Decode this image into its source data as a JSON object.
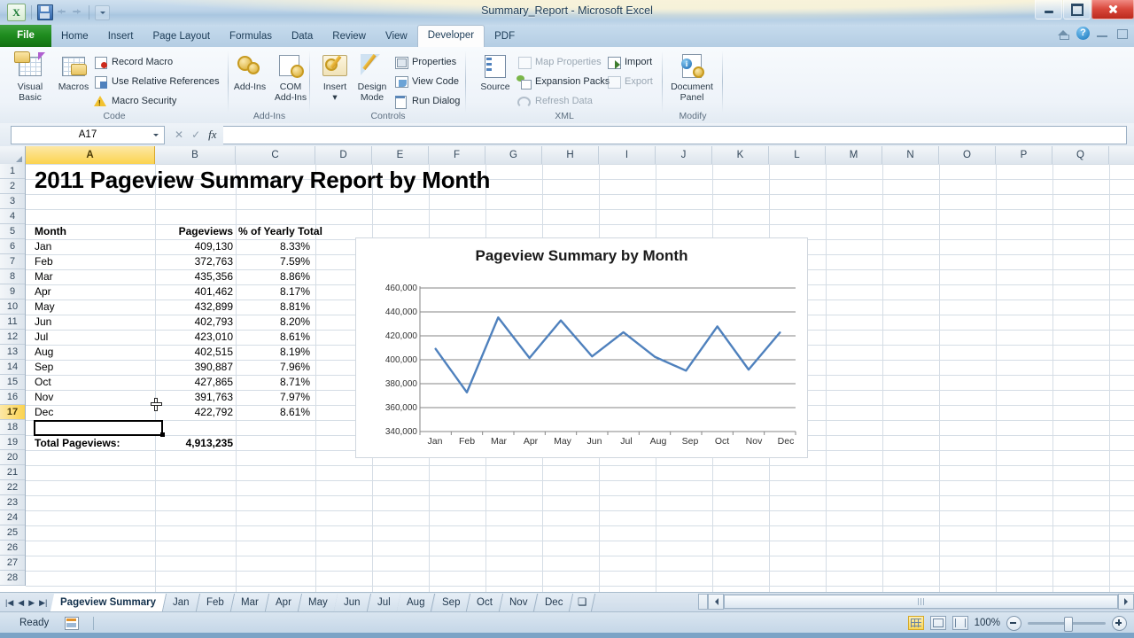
{
  "window": {
    "title": "Summary_Report  -  Microsoft Excel",
    "qat": {
      "excel_logo": "excel-logo",
      "save": "save-icon",
      "undo": "undo-icon",
      "redo": "redo-icon",
      "customize": "customize-qat-icon"
    },
    "buttons": {
      "minimize": "minimize",
      "maximize": "maximize",
      "close": "close"
    }
  },
  "ribbon": {
    "tabs": [
      {
        "label": "File",
        "active": false
      },
      {
        "label": "Home",
        "active": false
      },
      {
        "label": "Insert",
        "active": false
      },
      {
        "label": "Page Layout",
        "active": false
      },
      {
        "label": "Formulas",
        "active": false
      },
      {
        "label": "Data",
        "active": false
      },
      {
        "label": "Review",
        "active": false
      },
      {
        "label": "View",
        "active": false
      },
      {
        "label": "Developer",
        "active": true
      },
      {
        "label": "PDF",
        "active": false
      }
    ],
    "right_icons": [
      "home-icon",
      "help-icon",
      "minimize-ribbon-icon",
      "restore-window-icon"
    ],
    "groups": [
      {
        "name": "Code",
        "big_buttons": [
          {
            "label_line1": "Visual",
            "label_line2": "Basic",
            "icon": "visual-basic-icon"
          },
          {
            "label_line1": "Macros",
            "label_line2": "",
            "icon": "macros-icon"
          }
        ],
        "small_buttons": [
          {
            "label": "Record Macro",
            "icon": "record-macro-icon",
            "disabled": false
          },
          {
            "label": "Use Relative References",
            "icon": "relative-references-icon",
            "disabled": false
          },
          {
            "label": "Macro Security",
            "icon": "macro-security-icon",
            "disabled": false
          }
        ]
      },
      {
        "name": "Add-Ins",
        "big_buttons": [
          {
            "label_line1": "Add-Ins",
            "label_line2": "",
            "icon": "add-ins-icon"
          },
          {
            "label_line1": "COM",
            "label_line2": "Add-Ins",
            "icon": "com-add-ins-icon"
          }
        ],
        "small_buttons": []
      },
      {
        "name": "Controls",
        "big_buttons": [
          {
            "label_line1": "Insert",
            "label_line2": "▾",
            "icon": "insert-control-icon"
          },
          {
            "label_line1": "Design",
            "label_line2": "Mode",
            "icon": "design-mode-icon"
          }
        ],
        "small_buttons": [
          {
            "label": "Properties",
            "icon": "properties-icon",
            "disabled": false
          },
          {
            "label": "View Code",
            "icon": "view-code-icon",
            "disabled": false
          },
          {
            "label": "Run Dialog",
            "icon": "run-dialog-icon",
            "disabled": false
          }
        ]
      },
      {
        "name": "XML",
        "big_buttons": [
          {
            "label_line1": "Source",
            "label_line2": "",
            "icon": "xml-source-icon"
          }
        ],
        "small_buttons": [
          {
            "label": "Map Properties",
            "icon": "map-properties-icon",
            "disabled": true
          },
          {
            "label": "Expansion Packs",
            "icon": "expansion-packs-icon",
            "disabled": false
          },
          {
            "label": "Refresh Data",
            "icon": "refresh-data-icon",
            "disabled": true
          },
          {
            "label": "Import",
            "icon": "import-icon",
            "disabled": false
          },
          {
            "label": "Export",
            "icon": "export-icon",
            "disabled": true
          }
        ]
      },
      {
        "name": "Modify",
        "big_buttons": [
          {
            "label_line1": "Document",
            "label_line2": "Panel",
            "icon": "document-panel-icon"
          }
        ],
        "small_buttons": []
      }
    ]
  },
  "formula_bar": {
    "name_box_value": "A17",
    "formula_value": "",
    "cancel_icon": "cancel-icon",
    "enter_icon": "enter-icon",
    "fx_label": "fx"
  },
  "sheet": {
    "column_headers": [
      "A",
      "B",
      "C",
      "D",
      "E",
      "F",
      "G",
      "H",
      "I",
      "J",
      "K",
      "L",
      "M",
      "N",
      "O",
      "P",
      "Q"
    ],
    "selected_column": "A",
    "row_headers": [
      "1",
      "2",
      "3",
      "4",
      "5",
      "6",
      "7",
      "8",
      "9",
      "10",
      "11",
      "12",
      "13",
      "14",
      "15",
      "16",
      "17",
      "18",
      "19",
      "20",
      "21",
      "22",
      "23",
      "24",
      "25",
      "26",
      "27",
      "28"
    ],
    "selected_row": "17",
    "active_cell": "A17",
    "title_cell": "2011 Pageview Summary Report by Month",
    "table_headers": [
      "Month",
      "Pageviews",
      "% of Yearly Total"
    ],
    "rows": [
      {
        "row": "5",
        "month": "Jan",
        "pageviews": "409,130",
        "percent": "8.33%"
      },
      {
        "row": "6",
        "month": "Feb",
        "pageviews": "372,763",
        "percent": "7.59%"
      },
      {
        "row": "7",
        "month": "Mar",
        "pageviews": "435,356",
        "percent": "8.86%"
      },
      {
        "row": "8",
        "month": "Apr",
        "pageviews": "401,462",
        "percent": "8.17%"
      },
      {
        "row": "9",
        "month": "May",
        "pageviews": "432,899",
        "percent": "8.81%"
      },
      {
        "row": "10",
        "month": "Jun",
        "pageviews": "402,793",
        "percent": "8.20%"
      },
      {
        "row": "11",
        "month": "Jul",
        "pageviews": "423,010",
        "percent": "8.61%"
      },
      {
        "row": "12",
        "month": "Aug",
        "pageviews": "402,515",
        "percent": "8.19%"
      },
      {
        "row": "13",
        "month": "Sep",
        "pageviews": "390,887",
        "percent": "7.96%"
      },
      {
        "row": "14",
        "month": "Oct",
        "pageviews": "427,865",
        "percent": "8.71%"
      },
      {
        "row": "15",
        "month": "Nov",
        "pageviews": "391,763",
        "percent": "7.97%"
      },
      {
        "row": "16",
        "month": "Dec",
        "pageviews": "422,792",
        "percent": "8.61%"
      }
    ],
    "total_label": "Total Pageviews:",
    "total_value": "4,913,235"
  },
  "chart_data": {
    "type": "line",
    "title": "Pageview Summary by Month",
    "categories": [
      "Jan",
      "Feb",
      "Mar",
      "Apr",
      "May",
      "Jun",
      "Jul",
      "Aug",
      "Sep",
      "Oct",
      "Nov",
      "Dec"
    ],
    "values": [
      409130,
      372763,
      435356,
      401462,
      432899,
      402793,
      423010,
      402515,
      390887,
      427865,
      391763,
      422792
    ],
    "series": [
      {
        "name": "Pageviews",
        "values": [
          409130,
          372763,
          435356,
          401462,
          432899,
          402793,
          423010,
          402515,
          390887,
          427865,
          391763,
          422792
        ]
      }
    ],
    "xlabel": "",
    "ylabel": "",
    "ylim": [
      340000,
      460000
    ],
    "ytick_labels": [
      "460,000",
      "440,000",
      "420,000",
      "400,000",
      "380,000",
      "360,000",
      "340,000"
    ],
    "ytick_values": [
      460000,
      440000,
      420000,
      400000,
      380000,
      360000,
      340000
    ],
    "grid": true,
    "legend": false,
    "line_color": "#4f81bd"
  },
  "sheet_tabs": {
    "nav": [
      "first-sheet",
      "prev-sheet",
      "next-sheet",
      "last-sheet"
    ],
    "tabs": [
      {
        "label": "Pageview Summary",
        "active": true
      },
      {
        "label": "Jan",
        "active": false
      },
      {
        "label": "Feb",
        "active": false
      },
      {
        "label": "Mar",
        "active": false
      },
      {
        "label": "Apr",
        "active": false
      },
      {
        "label": "May",
        "active": false
      },
      {
        "label": "Jun",
        "active": false
      },
      {
        "label": "Jul",
        "active": false
      },
      {
        "label": "Aug",
        "active": false
      },
      {
        "label": "Sep",
        "active": false
      },
      {
        "label": "Oct",
        "active": false
      },
      {
        "label": "Nov",
        "active": false
      },
      {
        "label": "Dec",
        "active": false
      }
    ],
    "insert_sheet_icon": "insert-worksheet-icon"
  },
  "status_bar": {
    "mode": "Ready",
    "macro_record_icon": "record-macro-status-icon",
    "view_buttons": [
      {
        "name": "normal-view",
        "active": true
      },
      {
        "name": "page-layout-view",
        "active": false
      },
      {
        "name": "page-break-preview",
        "active": false
      }
    ],
    "zoom_level": "100%",
    "zoom_out_icon": "zoom-out-icon",
    "zoom_in_icon": "zoom-in-icon"
  }
}
